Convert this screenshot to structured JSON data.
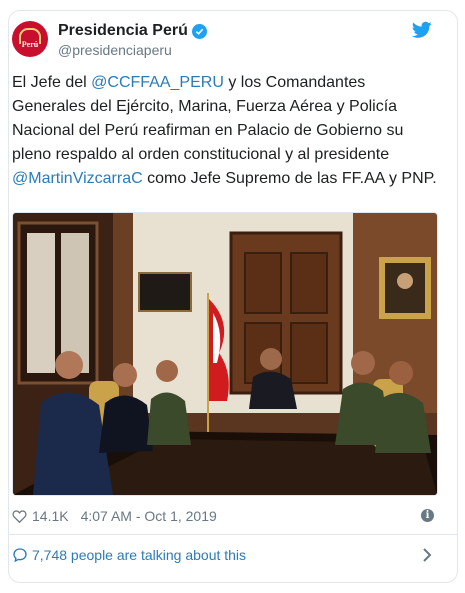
{
  "account": {
    "display_name": "Presidencia Perú",
    "handle": "@presidenciaperu",
    "avatar_text": "Perú"
  },
  "tweet": {
    "text_1": "El Jefe del ",
    "mention_1": "@CCFFAA_PERU",
    "text_2": " y los Comandantes Generales del Ejército, Marina, Fuerza Aérea y Policía Nacional del Perú reafirman en Palacio de Gobierno su pleno respaldo al orden constitucional y al presidente ",
    "mention_2": "@MartinVizcarraC",
    "text_3": " como Jefe Supremo de las FF.AA y PNP."
  },
  "meta": {
    "likes": "14.1K",
    "timestamp": "4:07 AM - Oct 1, 2019"
  },
  "footer": {
    "talking": "7,748 people are talking about this"
  },
  "colors": {
    "link": "#2b7bb9",
    "twitter_blue": "#1da1f2",
    "muted": "#697882",
    "avatar_red": "#c8102e"
  },
  "icons": {
    "verified": "verified-badge-icon",
    "bird": "twitter-bird-icon",
    "like": "heart-icon",
    "info": "info-icon",
    "conversation": "speech-bubble-icon",
    "chevron": "chevron-right-icon"
  }
}
